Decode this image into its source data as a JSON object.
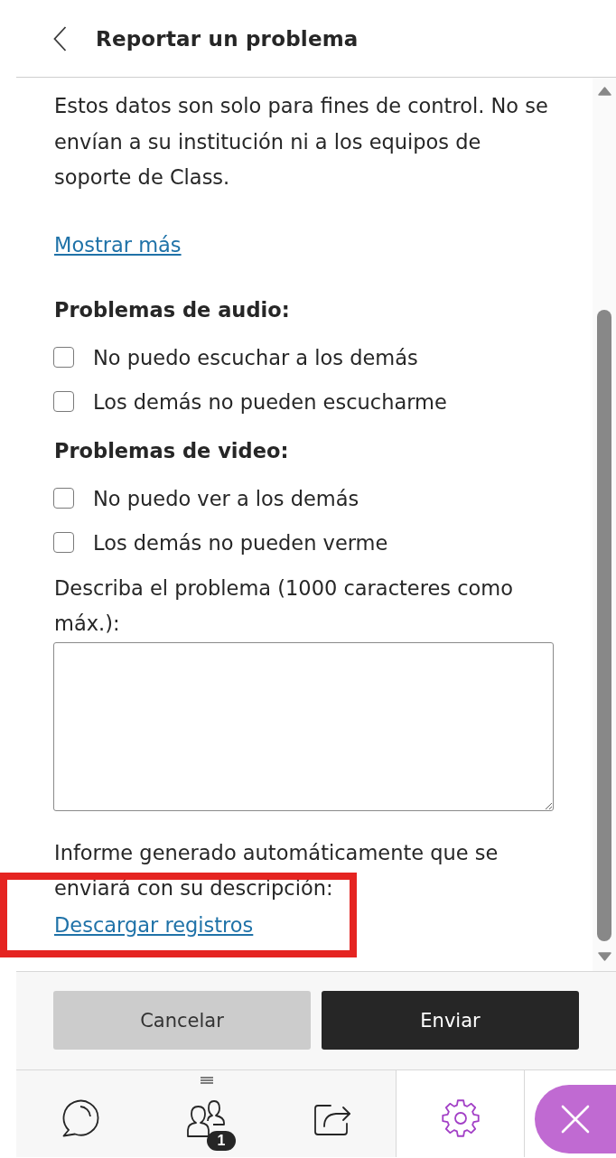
{
  "header": {
    "title": "Reportar un problema"
  },
  "intro": {
    "text": "Estos datos son solo para fines de control. No se envían a su institución ni a los equipos de soporte de Class.",
    "link": "Mostrar más"
  },
  "sections": [
    {
      "heading": "Problemas de audio:",
      "options": [
        {
          "label": "No puedo escuchar a los demás",
          "checked": false
        },
        {
          "label": "Los demás no pueden escucharme",
          "checked": false
        }
      ]
    },
    {
      "heading": "Problemas de video:",
      "options": [
        {
          "label": "No puedo ver a los demás",
          "checked": false
        },
        {
          "label": "Los demás no pueden verme",
          "checked": false
        }
      ]
    }
  ],
  "description": {
    "label": "Describa el problema (1000 caracteres como máx.):"
  },
  "report": {
    "text": "Informe generado automáticamente que se enviará con su descripción:",
    "link": "Descargar registros",
    "highlighted": true
  },
  "buttons": [
    {
      "label": "Cancelar",
      "kind": "secondary"
    },
    {
      "label": "Enviar",
      "kind": "primary"
    }
  ],
  "nav": [
    {
      "kind": "chat",
      "selected": false
    },
    {
      "kind": "participants",
      "badge": "1",
      "selected": false
    },
    {
      "kind": "share",
      "selected": false
    },
    {
      "kind": "settings",
      "selected": true
    },
    {
      "kind": "close",
      "selected": false
    }
  ]
}
